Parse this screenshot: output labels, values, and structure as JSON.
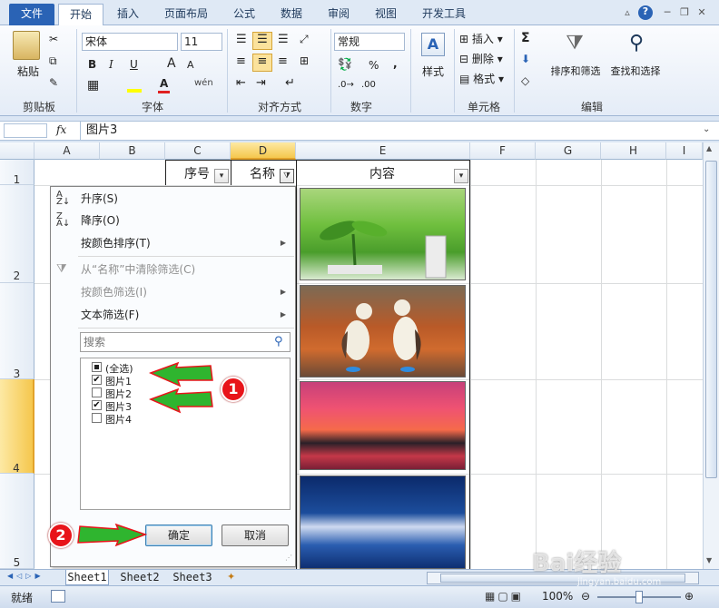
{
  "tabs": [
    "文件",
    "开始",
    "插入",
    "页面布局",
    "公式",
    "数据",
    "审阅",
    "视图",
    "开发工具"
  ],
  "active_tab": "开始",
  "ribbon": {
    "clipboard": {
      "paste": "粘贴",
      "label": "剪贴板"
    },
    "font": {
      "name": "宋体",
      "size": "11",
      "label": "字体",
      "bold": "B",
      "italic": "I",
      "underline": "U",
      "grow": "A",
      "shrink": "A",
      "wen": "wén"
    },
    "align": {
      "label": "对齐方式"
    },
    "number": {
      "format": "常规",
      "label": "数字",
      "percent": "%",
      "comma": ","
    },
    "style": {
      "label": "样式"
    },
    "cells": {
      "insert": "插入",
      "delete": "删除",
      "format": "格式",
      "label": "单元格"
    },
    "edit": {
      "sum": "Σ",
      "sort": "排序和筛选",
      "find": "查找和选择",
      "label": "编辑"
    }
  },
  "formula_bar": {
    "name_box": "",
    "fx": "fx",
    "content": "图片3"
  },
  "columns": [
    "A",
    "B",
    "C",
    "D",
    "E",
    "F",
    "G",
    "H",
    "I"
  ],
  "rows": [
    "1",
    "2",
    "3",
    "4",
    "5"
  ],
  "headers": {
    "c1": "序号",
    "d1": "名称",
    "e1": "内容"
  },
  "filter_menu": {
    "sort_asc": "升序(S)",
    "sort_desc": "降序(O)",
    "sort_color": "按颜色排序(T)",
    "clear_filter": "从“名称”中清除筛选(C)",
    "filter_color": "按颜色筛选(I)",
    "text_filter": "文本筛选(F)",
    "search_placeholder": "搜索",
    "items": [
      {
        "label": "(全选)",
        "state": "partial"
      },
      {
        "label": "图片1",
        "state": "checked"
      },
      {
        "label": "图片2",
        "state": "unchecked"
      },
      {
        "label": "图片3",
        "state": "checked"
      },
      {
        "label": "图片4",
        "state": "unchecked"
      }
    ],
    "ok": "确定",
    "cancel": "取消"
  },
  "annotations": {
    "step1": "1",
    "step2": "2"
  },
  "sheets": [
    "Sheet1",
    "Sheet2",
    "Sheet3"
  ],
  "active_sheet": "Sheet1",
  "status": {
    "ready": "就绪",
    "zoom": "100%"
  },
  "watermark": {
    "brand": "Bai经验",
    "url": "jingyan.baidu.com"
  },
  "colors": {
    "accent": "#2a63b5",
    "badge": "#e8141a",
    "arrow": "#2fb52f"
  }
}
